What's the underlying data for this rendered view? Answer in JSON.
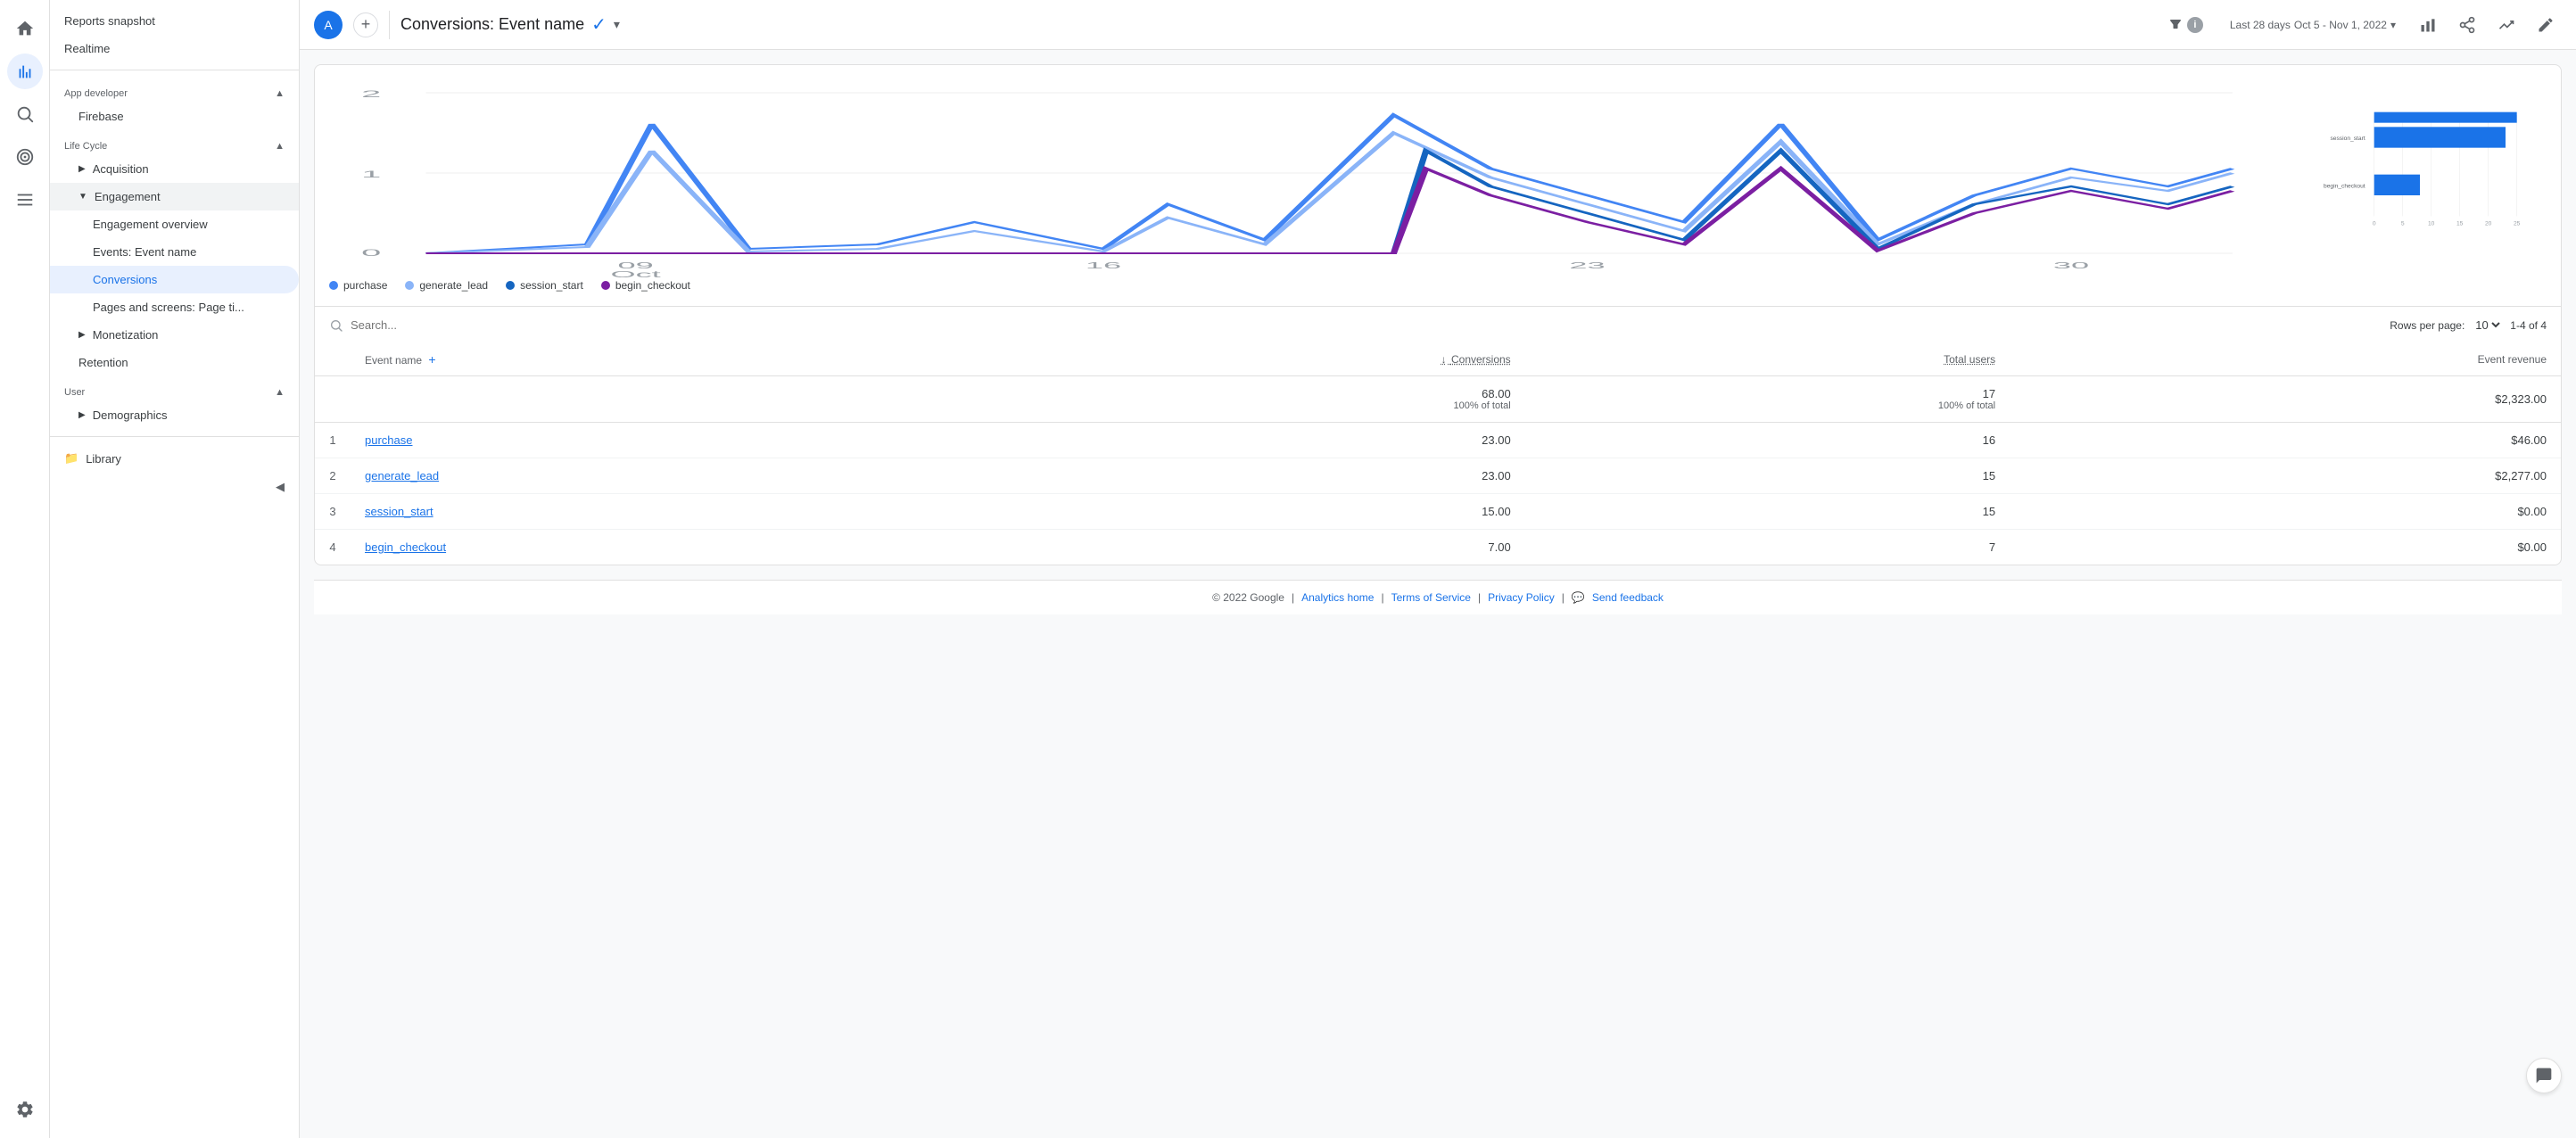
{
  "nav": {
    "icons": [
      {
        "name": "home-icon",
        "symbol": "⌂",
        "active": false
      },
      {
        "name": "analytics-icon",
        "symbol": "📊",
        "active": true
      },
      {
        "name": "search-icon",
        "symbol": "🔍",
        "active": false
      },
      {
        "name": "target-icon",
        "symbol": "◎",
        "active": false
      },
      {
        "name": "report-icon",
        "symbol": "☰",
        "active": false
      }
    ],
    "bottom_icon": {
      "name": "settings-icon",
      "symbol": "⚙"
    }
  },
  "sidebar": {
    "top_items": [
      {
        "label": "Reports snapshot",
        "indent": 0,
        "active": false
      },
      {
        "label": "Realtime",
        "indent": 0,
        "active": false
      }
    ],
    "sections": [
      {
        "title": "App developer",
        "expanded": true,
        "items": [
          {
            "label": "Firebase",
            "indent": 1,
            "active": false
          }
        ]
      },
      {
        "title": "Life Cycle",
        "expanded": true,
        "items": [
          {
            "label": "Acquisition",
            "indent": 1,
            "active": false,
            "has_arrow": true,
            "arrow_dir": "right"
          },
          {
            "label": "Engagement",
            "indent": 1,
            "active": false,
            "has_arrow": true,
            "arrow_dir": "down"
          },
          {
            "label": "Engagement overview",
            "indent": 2,
            "active": false
          },
          {
            "label": "Events: Event name",
            "indent": 2,
            "active": false
          },
          {
            "label": "Conversions",
            "indent": 2,
            "active": true
          },
          {
            "label": "Pages and screens: Page ti...",
            "indent": 2,
            "active": false
          },
          {
            "label": "Monetization",
            "indent": 1,
            "active": false,
            "has_arrow": true,
            "arrow_dir": "right"
          },
          {
            "label": "Retention",
            "indent": 1,
            "active": false
          }
        ]
      },
      {
        "title": "User",
        "expanded": true,
        "items": [
          {
            "label": "Demographics",
            "indent": 1,
            "active": false,
            "has_arrow": true,
            "arrow_dir": "right"
          }
        ]
      }
    ],
    "footer_items": [
      {
        "label": "Library",
        "icon": "folder"
      }
    ]
  },
  "topbar": {
    "avatar_letter": "A",
    "title": "Conversions: Event name",
    "date_label": "Last 28 days",
    "date_range": "Oct 5 - Nov 1, 2022",
    "filter_label": "▼",
    "info_label": "i"
  },
  "chart": {
    "line_labels": [
      "09\nOct",
      "16",
      "23",
      "30"
    ],
    "y_max": 2,
    "y_min": 0,
    "bar_labels": [
      "session_start",
      "begin_checkout"
    ],
    "bar_x_labels": [
      "0",
      "5",
      "10",
      "15",
      "20",
      "25"
    ],
    "legend": [
      {
        "label": "purchase",
        "color": "#4285f4"
      },
      {
        "label": "generate_lead",
        "color": "#4285f4"
      },
      {
        "label": "session_start",
        "color": "#1565c0"
      },
      {
        "label": "begin_checkout",
        "color": "#7b1fa2"
      }
    ]
  },
  "table": {
    "search_placeholder": "Search...",
    "rows_per_page_label": "Rows per page:",
    "rows_per_page_value": "10",
    "page_info": "1-4 of 4",
    "columns": [
      "Event name",
      "↓ Conversions",
      "Total users",
      "Event revenue"
    ],
    "totals": {
      "conversions": "68.00",
      "conversions_pct": "100% of total",
      "users": "17",
      "users_pct": "100% of total",
      "revenue": "$2,323.00"
    },
    "rows": [
      {
        "rank": "1",
        "event": "purchase",
        "conversions": "23.00",
        "users": "16",
        "revenue": "$46.00"
      },
      {
        "rank": "2",
        "event": "generate_lead",
        "conversions": "23.00",
        "users": "15",
        "revenue": "$2,277.00"
      },
      {
        "rank": "3",
        "event": "session_start",
        "conversions": "15.00",
        "users": "15",
        "revenue": "$0.00"
      },
      {
        "rank": "4",
        "event": "begin_checkout",
        "conversions": "7.00",
        "users": "7",
        "revenue": "$0.00"
      }
    ]
  },
  "footer": {
    "copyright": "© 2022 Google",
    "links": [
      "Analytics home",
      "Terms of Service",
      "Privacy Policy"
    ],
    "feedback": "Send feedback"
  }
}
